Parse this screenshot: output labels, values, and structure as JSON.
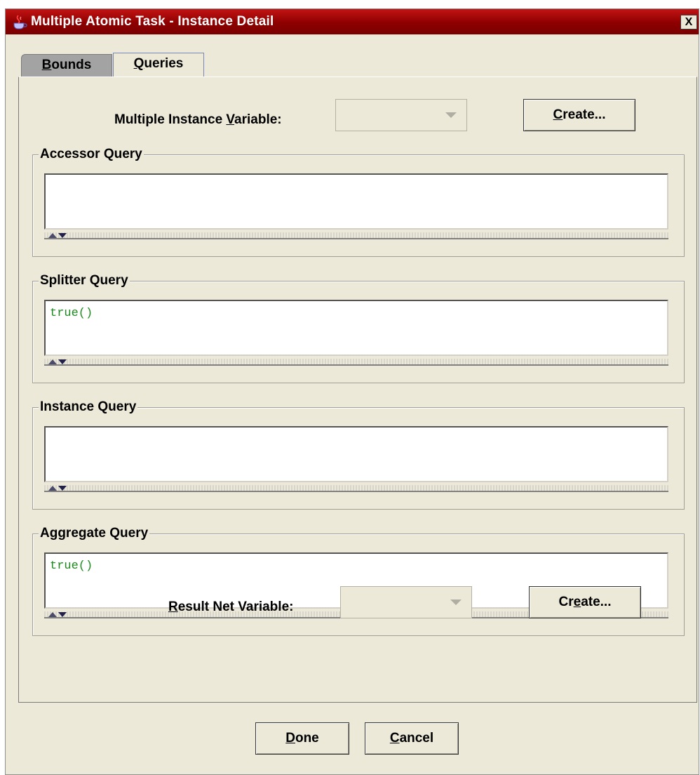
{
  "window": {
    "title": "Multiple Atomic Task - Instance Detail",
    "close_label": "X"
  },
  "tabs": [
    {
      "label": "Bounds",
      "mnemonic": "B",
      "rest": "ounds"
    },
    {
      "label": "Queries",
      "mnemonic": "Q",
      "rest": "ueries"
    }
  ],
  "mi_variable": {
    "label_pre": "Multiple Instance ",
    "label_mn": "V",
    "label_post": "ariable:",
    "value": ""
  },
  "create_top": {
    "mn": "C",
    "rest": "reate..."
  },
  "groups": [
    {
      "title": "Accessor Query",
      "value": ""
    },
    {
      "title": "Splitter Query",
      "value": "true()"
    },
    {
      "title": "Instance Query",
      "value": ""
    },
    {
      "title": "Aggregate Query",
      "value": "true()"
    }
  ],
  "result_variable": {
    "label_mn": "R",
    "label_post": "esult Net Variable:",
    "value": ""
  },
  "create_bottom": {
    "pre": "Cr",
    "mn": "e",
    "post": "ate..."
  },
  "done": {
    "mn": "D",
    "rest": "one"
  },
  "cancel": {
    "mn": "C",
    "rest": "ancel"
  },
  "colors": {
    "titlebar": "#8d0000",
    "editor_text": "#1c8a1c",
    "background": "#ece9d8"
  }
}
